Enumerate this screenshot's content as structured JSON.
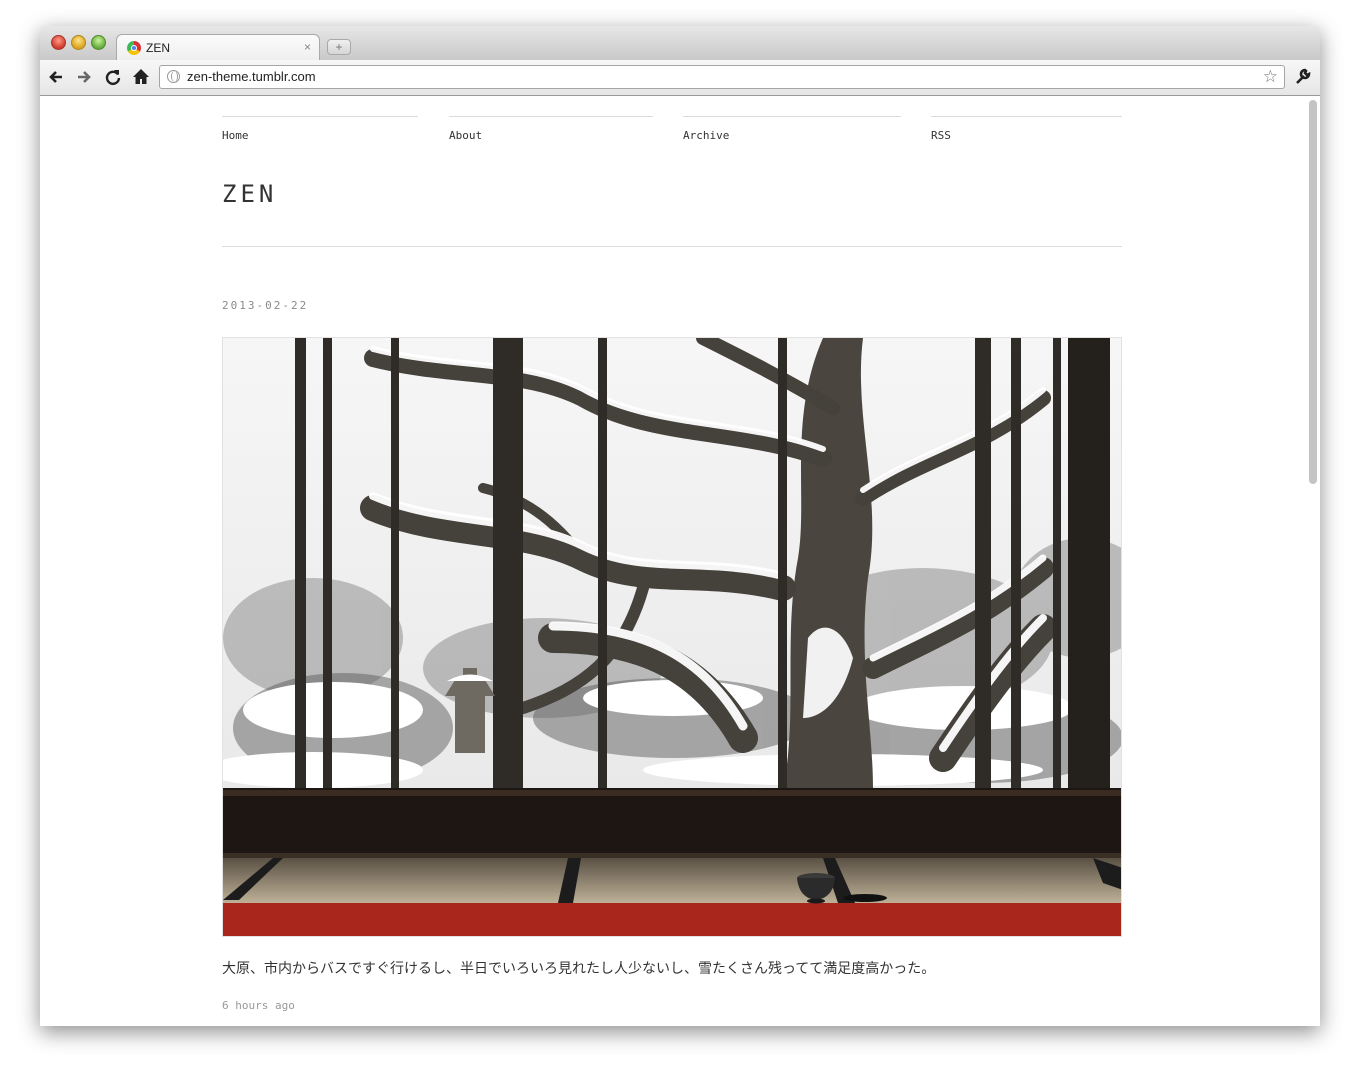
{
  "browser": {
    "tab_title": "ZEN",
    "tab_close": "×",
    "new_tab": "+",
    "url": "zen-theme.tumblr.com",
    "icons": [
      "back-icon",
      "forward-icon",
      "reload-icon",
      "home-icon",
      "bookmark-star-icon",
      "wrench-icon"
    ]
  },
  "site": {
    "nav": [
      {
        "label": "Home"
      },
      {
        "label": "About"
      },
      {
        "label": "Archive"
      },
      {
        "label": "RSS"
      }
    ],
    "title": "ZEN"
  },
  "post": {
    "date": "2013-02-22",
    "caption": "大原、市内からバスですぐ行けるし、半日でいろいろ見れたし人少ないし、雪たくさん残ってて満足度高かった。",
    "time_ago": "6 hours ago"
  },
  "colors": {
    "link": "#333333",
    "meta": "#8a8a8a",
    "rule": "#dcdcdc"
  }
}
